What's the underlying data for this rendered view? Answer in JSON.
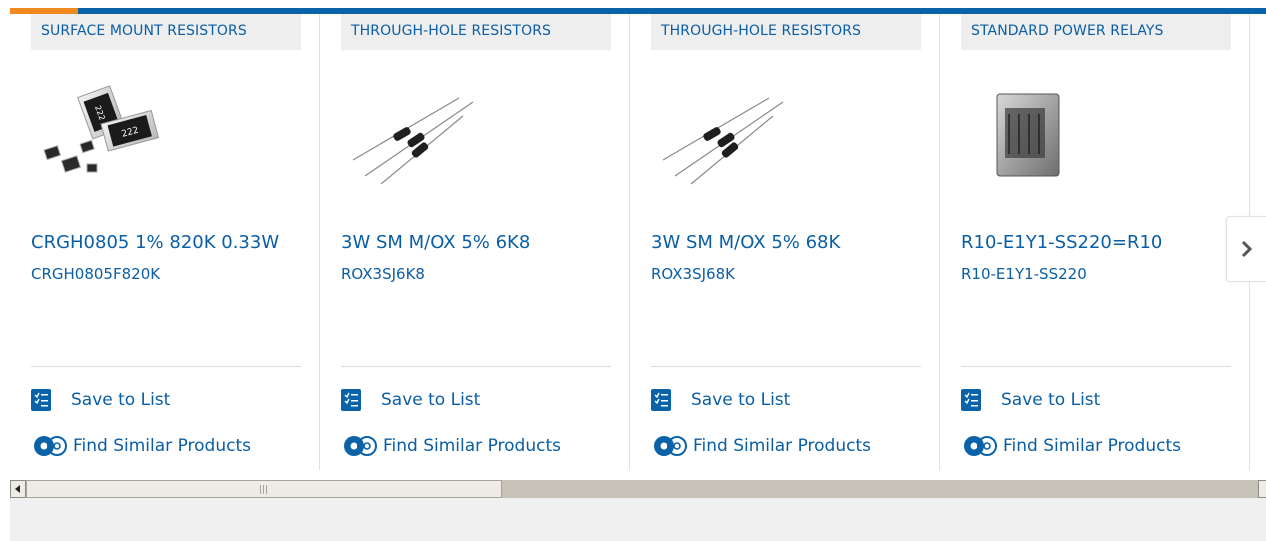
{
  "colors": {
    "accent_blue": "#0a63a9",
    "accent_orange": "#f08a1f",
    "link_blue": "#0a5ea6",
    "category_bg": "#eeeeee"
  },
  "products": [
    {
      "category": "SURFACE MOUNT RESISTORS",
      "name": "CRGH0805 1% 820K 0.33W",
      "part_number": "CRGH0805F820K",
      "image": "chip-resistors-image",
      "save_label": "Save to List",
      "similar_label": "Find Similar Products"
    },
    {
      "category": "THROUGH-HOLE RESISTORS",
      "name": "3W SM M/OX 5% 6K8",
      "part_number": "ROX3SJ6K8",
      "image": "axial-resistors-image",
      "save_label": "Save to List",
      "similar_label": "Find Similar Products"
    },
    {
      "category": "THROUGH-HOLE RESISTORS",
      "name": "3W SM M/OX 5% 68K",
      "part_number": "ROX3SJ68K",
      "image": "axial-resistors-image",
      "save_label": "Save to List",
      "similar_label": "Find Similar Products"
    },
    {
      "category": "STANDARD POWER RELAYS",
      "name": "R10-E1Y1-SS220=R10",
      "part_number": "R10-E1Y1-SS220",
      "image": "relay-image",
      "save_label": "Save to List",
      "similar_label": "Find Similar Products"
    }
  ],
  "carousel": {
    "next_icon": "chevron-right-icon"
  },
  "scrollbar": {
    "left_icon": "arrow-left-icon",
    "position": 0.0
  }
}
